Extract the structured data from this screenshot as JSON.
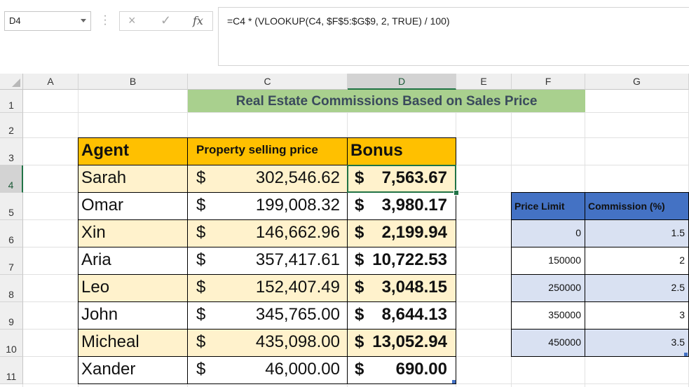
{
  "formula_bar": {
    "name_box": "D4",
    "cancel_icon": "×",
    "enter_icon": "✓",
    "fx_label": "fx",
    "formula": "=C4 * (VLOOKUP(C4, $F$5:$G$9, 2, TRUE) / 100)"
  },
  "columns": [
    "A",
    "B",
    "C",
    "D",
    "E",
    "F",
    "G"
  ],
  "rows": [
    "1",
    "2",
    "3",
    "4",
    "5",
    "6",
    "7",
    "8",
    "9",
    "10",
    "11"
  ],
  "title": "Real Estate Commissions Based on Sales Price",
  "agent_table": {
    "headers": {
      "agent": "Agent",
      "price": "Property selling price",
      "bonus": "Bonus"
    },
    "rows": [
      {
        "agent": "Sarah",
        "cur": "$",
        "price": "302,546.62",
        "bcur": "$",
        "bonus": "7,563.67"
      },
      {
        "agent": "Omar",
        "cur": "$",
        "price": "199,008.32",
        "bcur": "$",
        "bonus": "3,980.17"
      },
      {
        "agent": "Xin",
        "cur": "$",
        "price": "146,662.96",
        "bcur": "$",
        "bonus": "2,199.94"
      },
      {
        "agent": "Aria",
        "cur": "$",
        "price": "357,417.61",
        "bcur": "$",
        "bonus": "10,722.53"
      },
      {
        "agent": "Leo",
        "cur": "$",
        "price": "152,407.49",
        "bcur": "$",
        "bonus": "3,048.15"
      },
      {
        "agent": "John",
        "cur": "$",
        "price": "345,765.00",
        "bcur": "$",
        "bonus": "8,644.13"
      },
      {
        "agent": "Micheal",
        "cur": "$",
        "price": "435,098.00",
        "bcur": "$",
        "bonus": "13,052.94"
      },
      {
        "agent": "Xander",
        "cur": "$",
        "price": "46,000.00",
        "bcur": "$",
        "bonus": "690.00"
      }
    ]
  },
  "lookup_table": {
    "headers": {
      "limit": "Price Limit",
      "commission": "Commission (%)"
    },
    "rows": [
      {
        "limit": "0",
        "commission": "1.5"
      },
      {
        "limit": "150000",
        "commission": "2"
      },
      {
        "limit": "250000",
        "commission": "2.5"
      },
      {
        "limit": "350000",
        "commission": "3"
      },
      {
        "limit": "450000",
        "commission": "3.5"
      }
    ]
  },
  "active_cell": "D4",
  "colors": {
    "title_fill": "#a9d08e",
    "header_fill": "#ffc000",
    "band_fill": "#fff2cc",
    "lookup_header": "#4472c4",
    "lookup_band": "#d9e1f2",
    "selection": "#217346"
  }
}
